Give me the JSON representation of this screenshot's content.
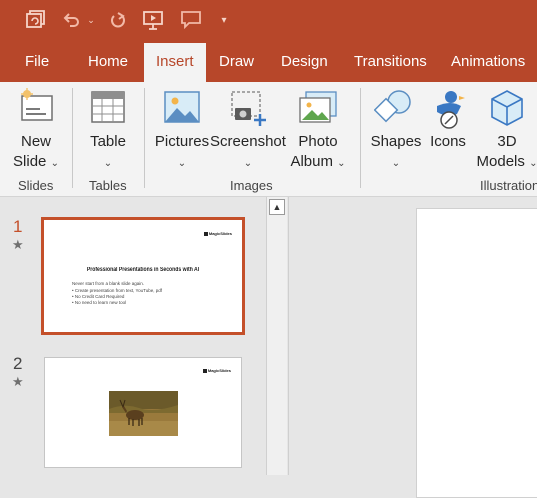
{
  "tabs": [
    {
      "label": "File"
    },
    {
      "label": "Home"
    },
    {
      "label": "Insert"
    },
    {
      "label": "Draw"
    },
    {
      "label": "Design"
    },
    {
      "label": "Transitions"
    },
    {
      "label": "Animations"
    }
  ],
  "ribbon": {
    "new_slide": {
      "line1": "New",
      "line2": "Slide"
    },
    "table": {
      "label": "Table"
    },
    "pictures": {
      "label": "Pictures"
    },
    "screenshot": {
      "label": "Screenshot"
    },
    "photo_album": {
      "line1": "Photo",
      "line2": "Album"
    },
    "shapes": {
      "label": "Shapes"
    },
    "icons": {
      "label": "Icons"
    },
    "models_3d": {
      "line1": "3D",
      "line2": "Models"
    },
    "groups": {
      "slides": "Slides",
      "tables": "Tables",
      "images": "Images",
      "illustrations": "Illustrations"
    }
  },
  "slides": [
    {
      "number": "1",
      "brand": "MagicSlides",
      "title": "Professional Presentations in Seconds with AI",
      "subtitle": "Never start from a blank slide again.",
      "bullets": [
        "• Create presentation from text, YouTube, pdf",
        "• No Credit Card Required",
        "• No need to learn new tool"
      ]
    },
    {
      "number": "2",
      "brand": "MagicSlides"
    }
  ],
  "colors": {
    "accent": "#b7472a",
    "selected_border": "#c4502a",
    "active_number": "#c4502a"
  }
}
